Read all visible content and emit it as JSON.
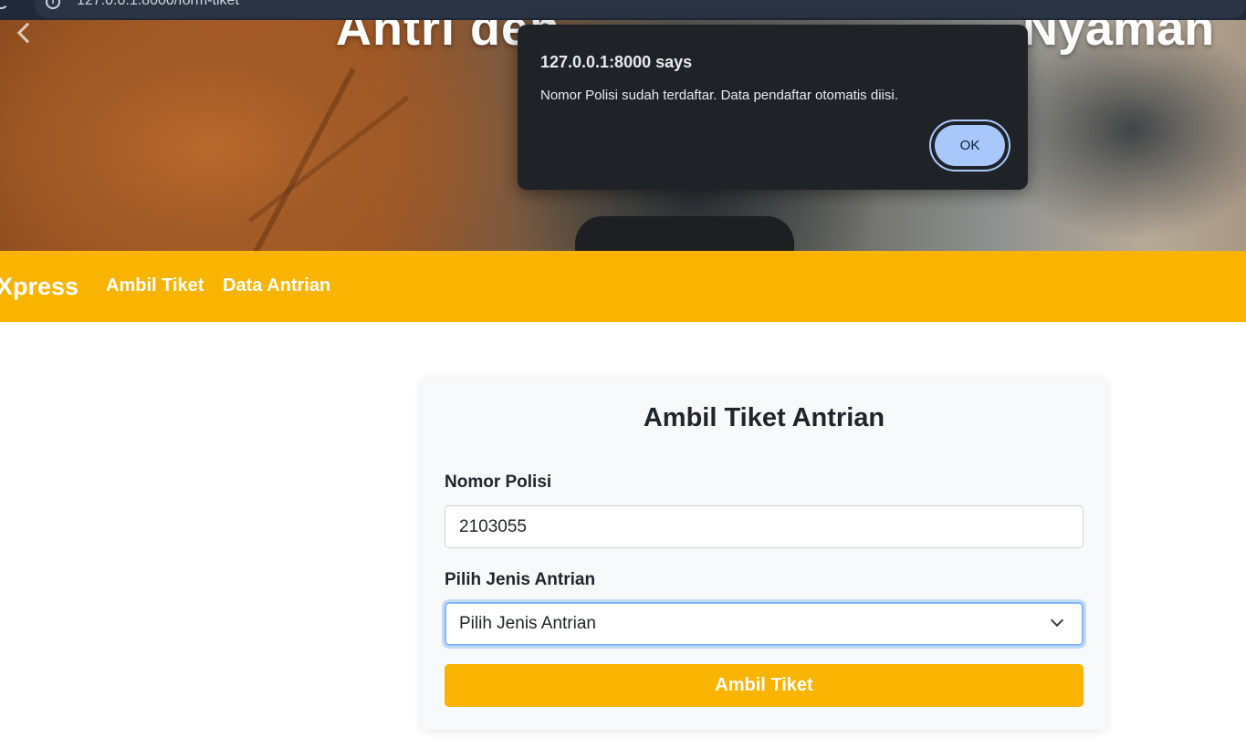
{
  "browser": {
    "url": "127.0.0.1:8000/form-tiket"
  },
  "hero": {
    "title_left": "Antri den",
    "title_right": "Nyaman"
  },
  "navbar": {
    "brand": "Xpress",
    "links": [
      "Ambil Tiket",
      "Data Antrian"
    ]
  },
  "form": {
    "title": "Ambil Tiket Antrian",
    "nomor_polisi_label": "Nomor Polisi",
    "nomor_polisi_value": "2103055",
    "jenis_label": "Pilih Jenis Antrian",
    "jenis_selected": "Pilih Jenis Antrian",
    "submit_label": "Ambil Tiket"
  },
  "dialog": {
    "title": "127.0.0.1:8000 says",
    "message": "Nomor Polisi sudah terdaftar. Data pendaftar otomatis diisi.",
    "ok_label": "OK"
  },
  "colors": {
    "accent": "#f8b400",
    "dialog_bg": "#1f2328",
    "ok_button": "#a8c7fa"
  }
}
